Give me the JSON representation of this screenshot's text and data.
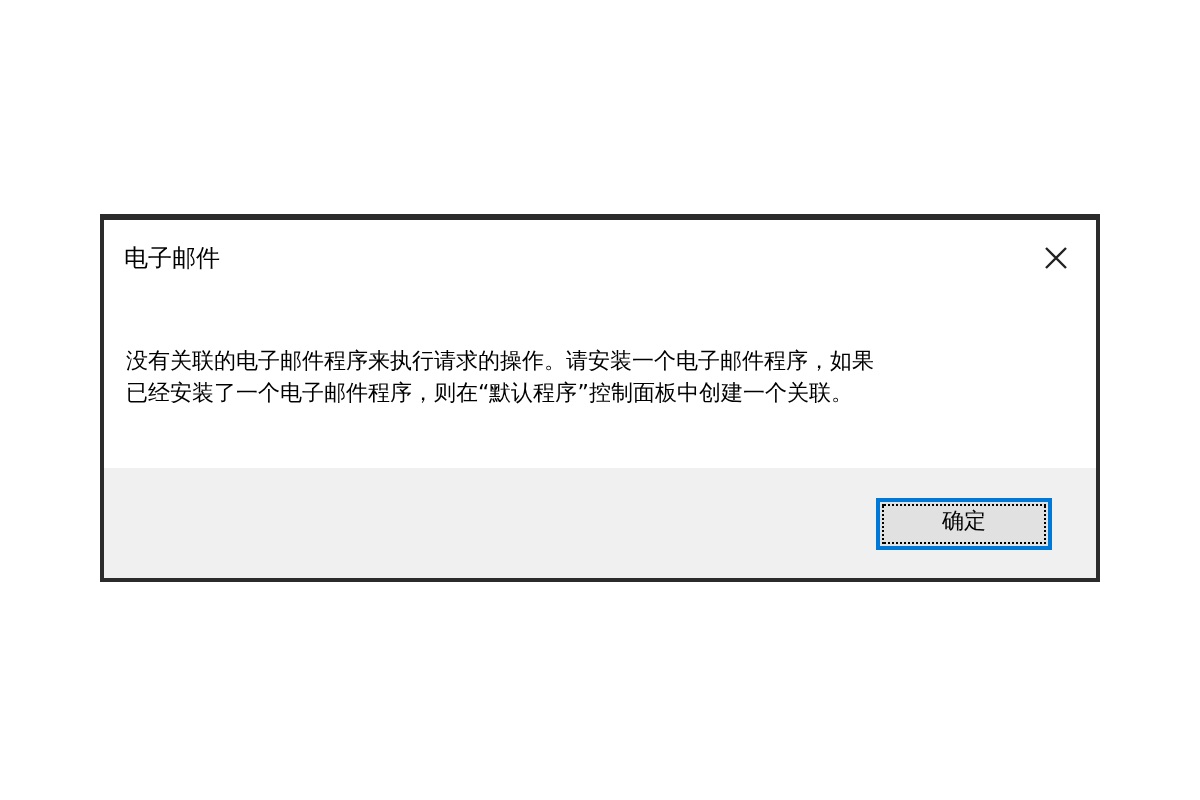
{
  "dialog": {
    "title": "电子邮件",
    "message": "没有关联的电子邮件程序来执行请求的操作。请安装一个电子邮件程序，如果已经安装了一个电子邮件程序，则在“默认程序”控制面板中创建一个关联。",
    "buttons": [
      {
        "label": "确定",
        "selected": true
      }
    ]
  }
}
